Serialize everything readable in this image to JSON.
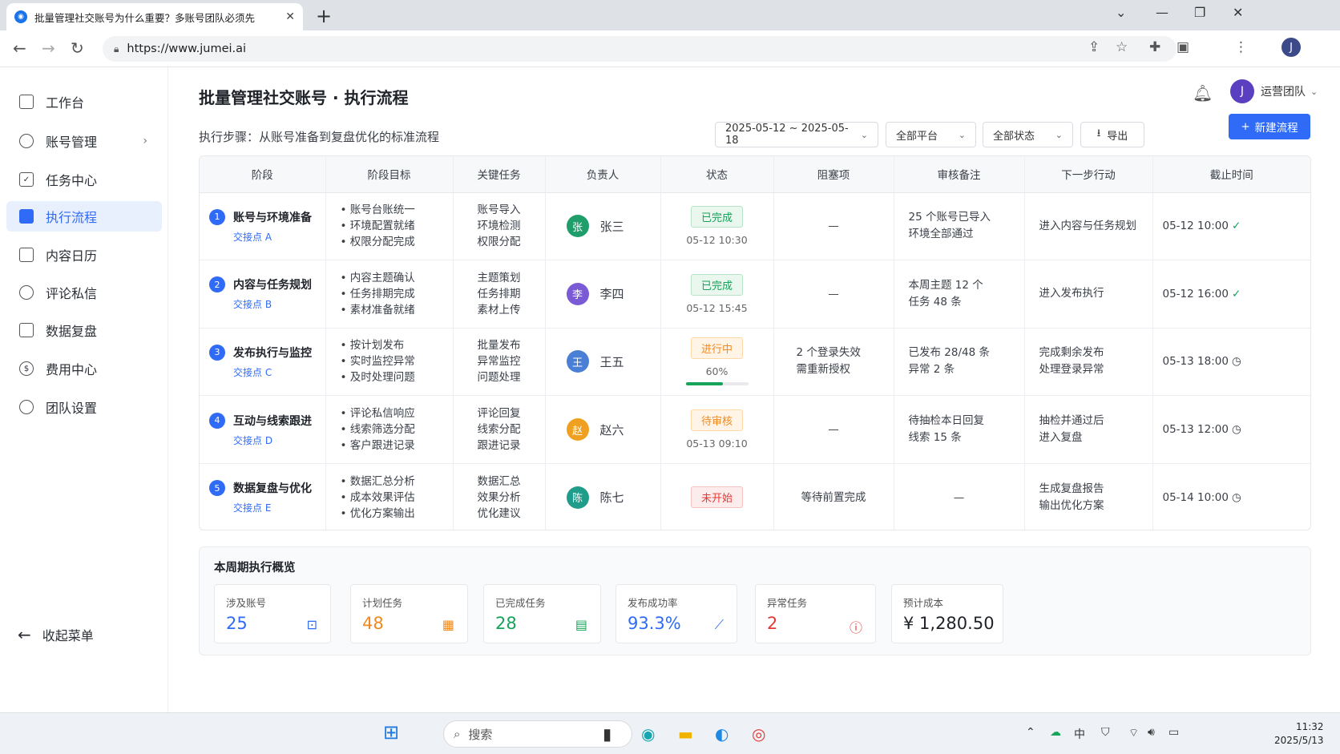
{
  "browser": {
    "tab_title": "批量管理社交账号为什么重要？多账号团队必须先",
    "url": "https://www.jumei.ai",
    "profile_initial": "J"
  },
  "sidebar": {
    "items": [
      {
        "label": "工作台",
        "icon": "dashboard-icon"
      },
      {
        "label": "账号管理",
        "icon": "users-icon",
        "chevron": "›"
      },
      {
        "label": "任务中心",
        "icon": "task-icon"
      },
      {
        "label": "执行流程",
        "icon": "flow-icon"
      },
      {
        "label": "内容日历",
        "icon": "calendar-icon"
      },
      {
        "label": "评论私信",
        "icon": "chat-icon"
      },
      {
        "label": "数据复盘",
        "icon": "chart-icon"
      },
      {
        "label": "费用中心",
        "icon": "cost-icon"
      },
      {
        "label": "团队设置",
        "icon": "gear-icon"
      }
    ],
    "collapse_label": "收起菜单"
  },
  "header": {
    "title": "批量管理社交账号 · 执行流程",
    "subtitle": "执行步骤：从账号准备到复盘优化的标准流程",
    "team_initial": "J",
    "team_label": "运营团队",
    "date_range": "2025-05-12 ~ 2025-05-18",
    "platform_filter": "全部平台",
    "status_filter": "全部状态",
    "export_label": "导出",
    "new_flow_label": "新建流程"
  },
  "table": {
    "headers": [
      "阶段",
      "阶段目标",
      "关键任务",
      "负责人",
      "状态",
      "阻塞项",
      "审核备注",
      "下一步行动",
      "截止时间"
    ],
    "rows": [
      {
        "num": "1",
        "stage": "账号与环境准备",
        "handoff": "交接点 A",
        "goals": [
          "• 账号台账统一",
          "• 环境配置就绪",
          "• 权限分配完成"
        ],
        "tasks": [
          "账号导入",
          "环境检测",
          "权限分配"
        ],
        "owner_initial": "张",
        "owner": "张三",
        "owner_color": "#1f9d6b",
        "status": "已完成",
        "status_type": "done",
        "status_sub": "05-12 10:30",
        "blocker": "—",
        "notes": [
          "25 个账号已导入",
          "环境全部通过"
        ],
        "next": [
          "进入内容与任务规划"
        ],
        "deadline": "05-12 10:00",
        "deadline_icon": "check-circle-icon"
      },
      {
        "num": "2",
        "stage": "内容与任务规划",
        "handoff": "交接点 B",
        "goals": [
          "• 内容主题确认",
          "• 任务排期完成",
          "• 素材准备就绪"
        ],
        "tasks": [
          "主题策划",
          "任务排期",
          "素材上传"
        ],
        "owner_initial": "李",
        "owner": "李四",
        "owner_color": "#7b5ad6",
        "status": "已完成",
        "status_type": "done",
        "status_sub": "05-12 15:45",
        "blocker": "—",
        "notes": [
          "本周主题 12 个",
          "任务 48 条"
        ],
        "next": [
          "进入发布执行"
        ],
        "deadline": "05-12 16:00",
        "deadline_icon": "check-circle-icon"
      },
      {
        "num": "3",
        "stage": "发布执行与监控",
        "handoff": "交接点 C",
        "goals": [
          "• 按计划发布",
          "• 实时监控异常",
          "• 及时处理问题"
        ],
        "tasks": [
          "批量发布",
          "异常监控",
          "问题处理"
        ],
        "owner_initial": "王",
        "owner": "王五",
        "owner_color": "#4a7fd6",
        "status": "进行中",
        "status_type": "progress",
        "status_sub": "60%",
        "progress": 0.6,
        "blocker_lines": [
          "2 个登录失效",
          "需重新授权"
        ],
        "notes": [
          "已发布 28/48 条",
          "异常 2 条"
        ],
        "next": [
          "完成剩余发布",
          "处理登录异常"
        ],
        "deadline": "05-13 18:00",
        "deadline_icon": "clock-icon"
      },
      {
        "num": "4",
        "stage": "互动与线索跟进",
        "handoff": "交接点 D",
        "goals": [
          "• 评论私信响应",
          "• 线索筛选分配",
          "• 客户跟进记录"
        ],
        "tasks": [
          "评论回复",
          "线索分配",
          "跟进记录"
        ],
        "owner_initial": "赵",
        "owner": "赵六",
        "owner_color": "#f0a020",
        "status": "待审核",
        "status_type": "review",
        "status_sub": "05-13 09:10",
        "blocker": "—",
        "notes": [
          "待抽检本日回复",
          "线索 15 条"
        ],
        "next": [
          "抽检并通过后",
          "进入复盘"
        ],
        "deadline": "05-13 12:00",
        "deadline_icon": "clock-icon"
      },
      {
        "num": "5",
        "stage": "数据复盘与优化",
        "handoff": "交接点 E",
        "goals": [
          "• 数据汇总分析",
          "• 成本效果评估",
          "• 优化方案输出"
        ],
        "tasks": [
          "数据汇总",
          "效果分析",
          "优化建议"
        ],
        "owner_initial": "陈",
        "owner": "陈七",
        "owner_color": "#1f9d8a",
        "status": "未开始",
        "status_type": "notstarted",
        "status_sub": "",
        "blocker": "等待前置完成",
        "notes": [
          "—"
        ],
        "next": [
          "生成复盘报告",
          "输出优化方案"
        ],
        "deadline": "05-14 10:00",
        "deadline_icon": "clock-icon"
      }
    ]
  },
  "summary": {
    "title": "本周期执行概览",
    "cards": [
      {
        "label": "涉及账号",
        "value": "25",
        "icon": "account-icon",
        "color": "#2f6bf6"
      },
      {
        "label": "计划任务",
        "value": "48",
        "icon": "calendar-icon",
        "color": "#f08a20"
      },
      {
        "label": "已完成任务",
        "value": "28",
        "icon": "doc-icon",
        "color": "#16a35a"
      },
      {
        "label": "发布成功率",
        "value": "93.3%",
        "icon": "trend-icon",
        "color": "#2f6bf6"
      },
      {
        "label": "异常任务",
        "value": "2",
        "icon": "alert-icon",
        "color": "#e53935"
      },
      {
        "label": "预计成本",
        "value": "¥ 1,280.50",
        "icon": "",
        "color": "#1f2329"
      }
    ]
  },
  "taskbar": {
    "search_label": "搜索",
    "time": "11:32",
    "date": "2025/5/13"
  },
  "colors": {
    "accent": "#2f6bf6",
    "done": "#16a35a",
    "progress": "#f08a20",
    "notstarted": "#e53935"
  }
}
